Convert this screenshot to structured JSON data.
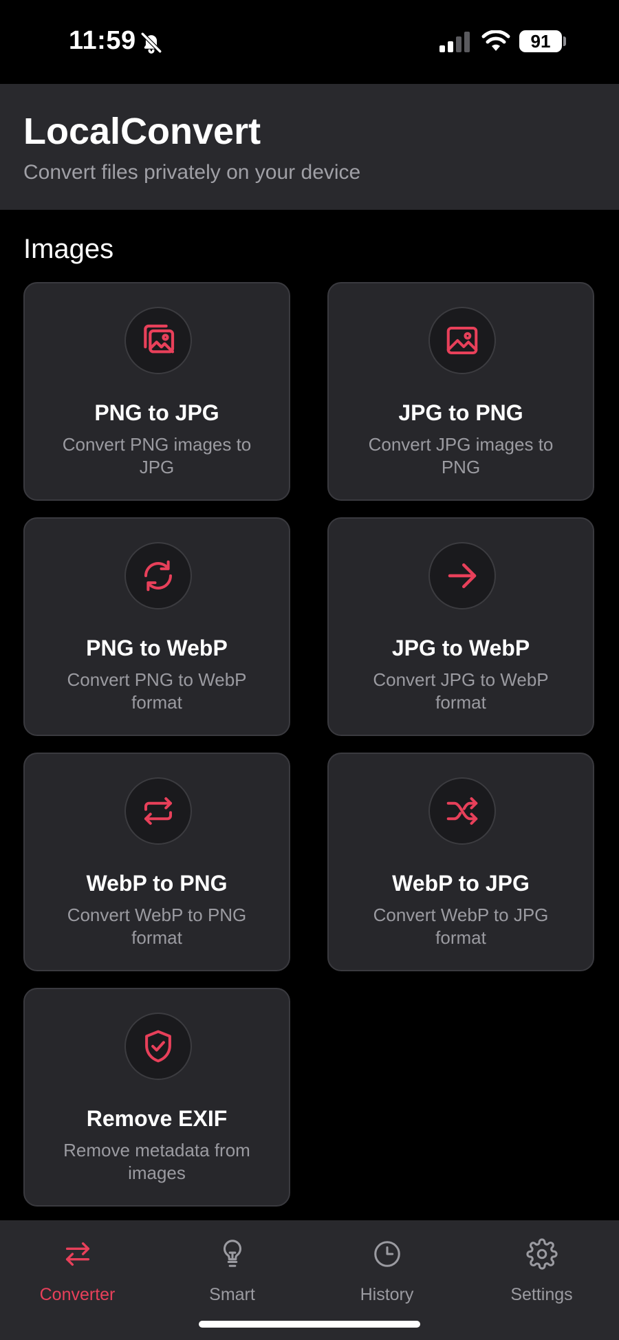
{
  "status": {
    "time": "11:59",
    "battery": "91"
  },
  "header": {
    "title": "LocalConvert",
    "subtitle": "Convert files privately on your device"
  },
  "section": {
    "title": "Images"
  },
  "accent_color": "#e8405a",
  "cards": [
    {
      "title": "PNG to JPG",
      "desc": "Convert PNG images to JPG",
      "icon": "images-icon"
    },
    {
      "title": "JPG to PNG",
      "desc": "Convert JPG images to PNG",
      "icon": "image-icon"
    },
    {
      "title": "PNG to WebP",
      "desc": "Convert PNG to WebP format",
      "icon": "refresh-icon"
    },
    {
      "title": "JPG to WebP",
      "desc": "Convert JPG to WebP format",
      "icon": "arrow-right-icon"
    },
    {
      "title": "WebP to PNG",
      "desc": "Convert WebP to PNG format",
      "icon": "repeat-icon"
    },
    {
      "title": "WebP to JPG",
      "desc": "Convert WebP to JPG format",
      "icon": "shuffle-icon"
    },
    {
      "title": "Remove EXIF",
      "desc": "Remove metadata from images",
      "icon": "shield-check-icon"
    }
  ],
  "tabs": [
    {
      "label": "Converter",
      "icon": "swap-icon",
      "active": true
    },
    {
      "label": "Smart",
      "icon": "lightbulb-icon",
      "active": false
    },
    {
      "label": "History",
      "icon": "clock-icon",
      "active": false
    },
    {
      "label": "Settings",
      "icon": "gear-icon",
      "active": false
    }
  ]
}
